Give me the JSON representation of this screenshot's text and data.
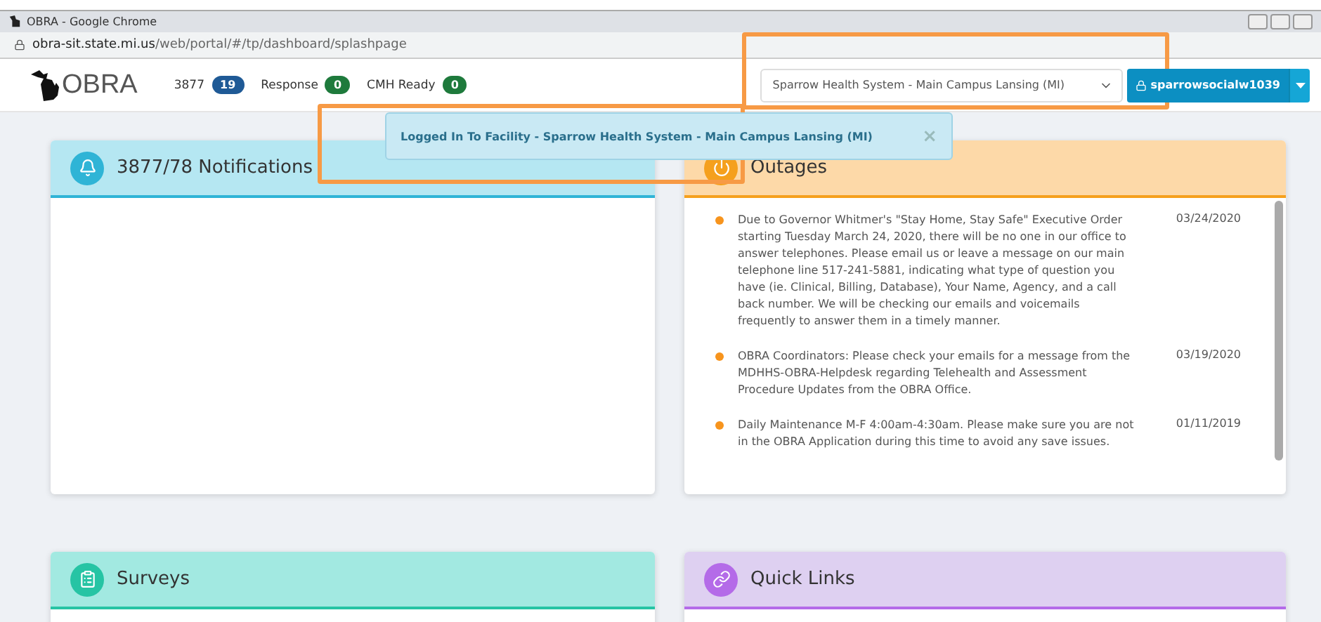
{
  "browser": {
    "title": "OBRA - Google Chrome",
    "url_host": "obra-sit.state.mi.us",
    "url_path": "/web/portal/#/tp/dashboard/splashpage"
  },
  "header": {
    "logo": "OBRA",
    "counters": [
      {
        "label": "3877",
        "count": "19",
        "color": "#1f5a96"
      },
      {
        "label": "Response",
        "count": "0",
        "color": "#1e7a3c"
      },
      {
        "label": "CMH Ready",
        "count": "0",
        "color": "#1e7a3c"
      }
    ],
    "facility_select": "Sparrow Health System - Main Campus Lansing (MI)",
    "user_button": "sparrowsocialw1039"
  },
  "toast": {
    "message": "Logged In To Facility - Sparrow Health System - Main Campus Lansing (MI)",
    "close": "×"
  },
  "cards": [
    {
      "kind": "notifications",
      "title": "3877/78 Notifications"
    },
    {
      "kind": "outages",
      "title": "Outages",
      "items": [
        {
          "text": "Due to Governor Whitmer's \"Stay Home, Stay Safe\" Executive Order starting Tuesday March 24, 2020, there will be no one in our office to answer telephones. Please email us or leave a message on our main telephone line 517-241-5881, indicating what type of question you have (ie. Clinical, Billing, Database), Your Name, Agency, and a call back number. We will be checking our emails and voicemails frequently to answer them in a timely manner.",
          "date": "03/24/2020"
        },
        {
          "text": "OBRA Coordinators: Please check your emails for a message from the MDHHS-OBRA-Helpdesk regarding Telehealth and Assessment Procedure Updates from the OBRA Office.",
          "date": "03/19/2020"
        },
        {
          "text": "Daily Maintenance M-F 4:00am-4:30am. Please make sure you are not in the OBRA Application during this time to avoid any save issues.",
          "date": "01/11/2019"
        }
      ]
    },
    {
      "kind": "surveys",
      "title": "Surveys"
    },
    {
      "kind": "links",
      "title": "Quick Links"
    }
  ]
}
